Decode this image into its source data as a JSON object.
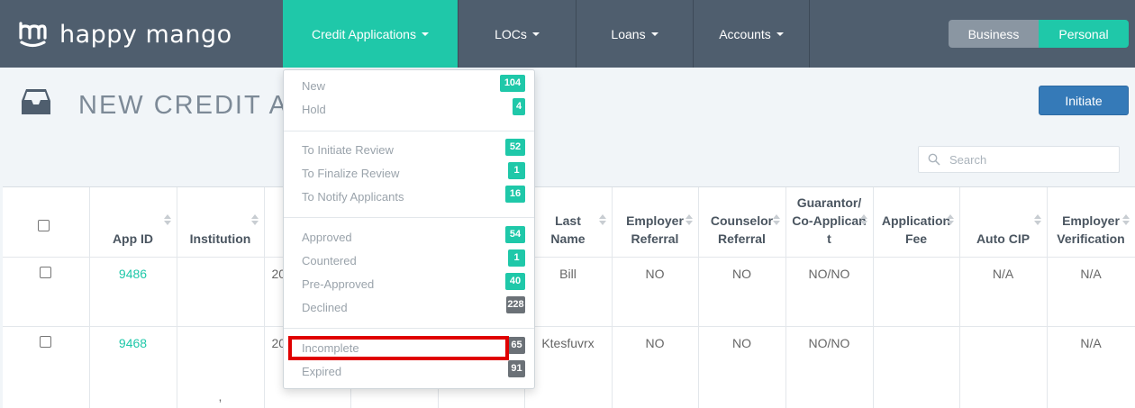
{
  "brand": {
    "name": "happy mango"
  },
  "nav": {
    "items": [
      {
        "label": "Credit Applications"
      },
      {
        "label": "LOCs"
      },
      {
        "label": "Loans"
      },
      {
        "label": "Accounts"
      }
    ],
    "toggle": {
      "business": "Business",
      "personal": "Personal"
    }
  },
  "page": {
    "title": "NEW CREDIT A",
    "initiate_label": "Initiate",
    "search_placeholder": "Search"
  },
  "table": {
    "headers": {
      "app_id": "App ID",
      "institution": "Institution",
      "last_name_1": "Last",
      "last_name_2": "Name",
      "employer_referral_1": "Employer",
      "employer_referral_2": "Referral",
      "counselor_referral_1": "Counselor",
      "counselor_referral_2": "Referral",
      "guarantor_1": "Guarantor/",
      "guarantor_2": "Co-Applican",
      "guarantor_3": "t",
      "application_fee_1": "Application",
      "application_fee_2": "Fee",
      "auto_cip": "Auto CIP",
      "employer_verification_1": "Employer",
      "employer_verification_2": "Verification"
    },
    "rows": [
      {
        "app_id": "9486",
        "date": "20",
        "last_name": "Bill",
        "employer_referral": "NO",
        "counselor_referral": "NO",
        "guarantor": "NO/NO",
        "application_fee": "",
        "auto_cip": "N/A",
        "employer_verification": "N/A",
        "institution": ""
      },
      {
        "app_id": "9468",
        "date": "20",
        "last_name": "Ktesfuvrx",
        "employer_referral": "NO",
        "counselor_referral": "NO",
        "guarantor": "NO/NO",
        "application_fee": "",
        "auto_cip": "",
        "employer_verification": "N/A",
        "institution": ","
      }
    ]
  },
  "dropdown": {
    "items": [
      {
        "label": "New",
        "count": "104",
        "color": "green"
      },
      {
        "label": "Hold",
        "count": "4",
        "color": "green"
      },
      {
        "label": "To Initiate Review",
        "count": "52",
        "color": "green"
      },
      {
        "label": "To Finalize Review",
        "count": "1",
        "color": "green"
      },
      {
        "label": "To Notify Applicants",
        "count": "16",
        "color": "green"
      },
      {
        "label": "Approved",
        "count": "54",
        "color": "green"
      },
      {
        "label": "Countered",
        "count": "1",
        "color": "green"
      },
      {
        "label": "Pre-Approved",
        "count": "40",
        "color": "green"
      },
      {
        "label": "Declined",
        "count": "228",
        "color": "gray"
      },
      {
        "label": "Incomplete",
        "count": "65",
        "color": "gray"
      },
      {
        "label": "Expired",
        "count": "91",
        "color": "gray"
      }
    ]
  },
  "colors": {
    "navbar": "#4f5e6e",
    "accent": "#1fc8a9",
    "primary_button": "#357ab8",
    "highlight": "#e00000"
  }
}
